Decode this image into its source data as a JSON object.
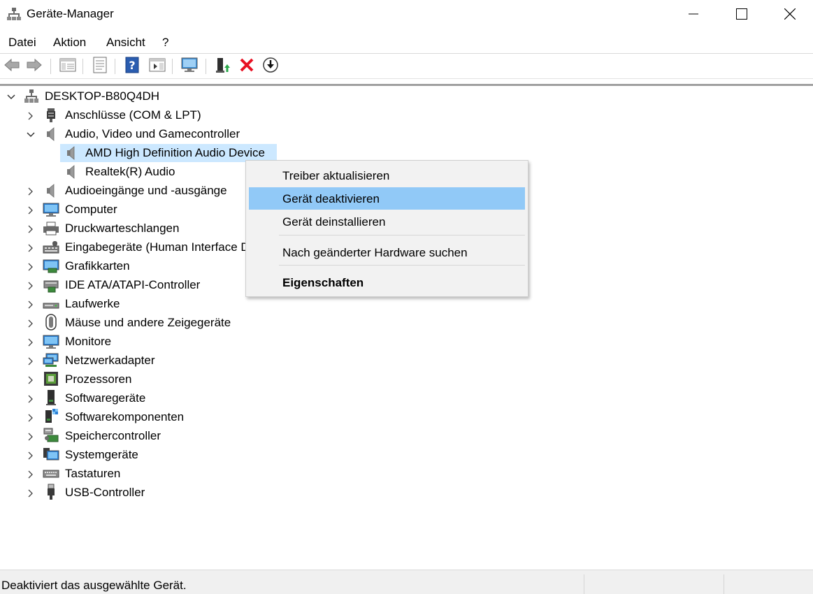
{
  "window": {
    "title": "Geräte-Manager"
  },
  "menubar": {
    "items": [
      "Datei",
      "Aktion",
      "Ansicht",
      "?"
    ]
  },
  "tree": {
    "root": "DESKTOP-B80Q4DH",
    "categories": [
      {
        "label": "Anschlüsse (COM & LPT)",
        "icon": "port-icon"
      },
      {
        "label": "Audio, Video und Gamecontroller",
        "icon": "speaker-icon",
        "expanded": true
      },
      {
        "label": "Audioeingänge und -ausgänge",
        "icon": "speaker-icon"
      },
      {
        "label": "Computer",
        "icon": "computer-icon"
      },
      {
        "label": "Druckwarteschlangen",
        "icon": "printer-icon"
      },
      {
        "label": "Eingabegeräte (Human Interface D",
        "icon": "hid-icon"
      },
      {
        "label": "Grafikkarten",
        "icon": "display-adapter-icon"
      },
      {
        "label": "IDE ATA/ATAPI-Controller",
        "icon": "ide-controller-icon"
      },
      {
        "label": "Laufwerke",
        "icon": "drive-icon"
      },
      {
        "label": "Mäuse und andere Zeigegeräte",
        "icon": "mouse-icon"
      },
      {
        "label": "Monitore",
        "icon": "monitor-icon"
      },
      {
        "label": "Netzwerkadapter",
        "icon": "network-icon"
      },
      {
        "label": "Prozessoren",
        "icon": "cpu-icon"
      },
      {
        "label": "Softwaregeräte",
        "icon": "software-device-icon"
      },
      {
        "label": "Softwarekomponenten",
        "icon": "software-component-icon"
      },
      {
        "label": "Speichercontroller",
        "icon": "storage-controller-icon"
      },
      {
        "label": "Systemgeräte",
        "icon": "system-device-icon"
      },
      {
        "label": "Tastaturen",
        "icon": "keyboard-icon"
      },
      {
        "label": "USB-Controller",
        "icon": "usb-icon"
      }
    ],
    "audio_children": [
      {
        "label": "AMD High Definition Audio Device",
        "selected": true
      },
      {
        "label": "Realtek(R) Audio"
      }
    ]
  },
  "context_menu": {
    "items": [
      {
        "label": "Treiber aktualisieren"
      },
      {
        "label": "Gerät deaktivieren",
        "highlighted": true
      },
      {
        "label": "Gerät deinstallieren"
      },
      {
        "label": "Nach geänderter Hardware suchen"
      },
      {
        "label": "Eigenschaften",
        "bold": true
      }
    ]
  },
  "statusbar": {
    "text": "Deaktiviert das ausgewählte Gerät."
  },
  "colors": {
    "selection": "#cce8ff",
    "menu_highlight": "#91c9f7",
    "delete_red": "#e81123"
  }
}
